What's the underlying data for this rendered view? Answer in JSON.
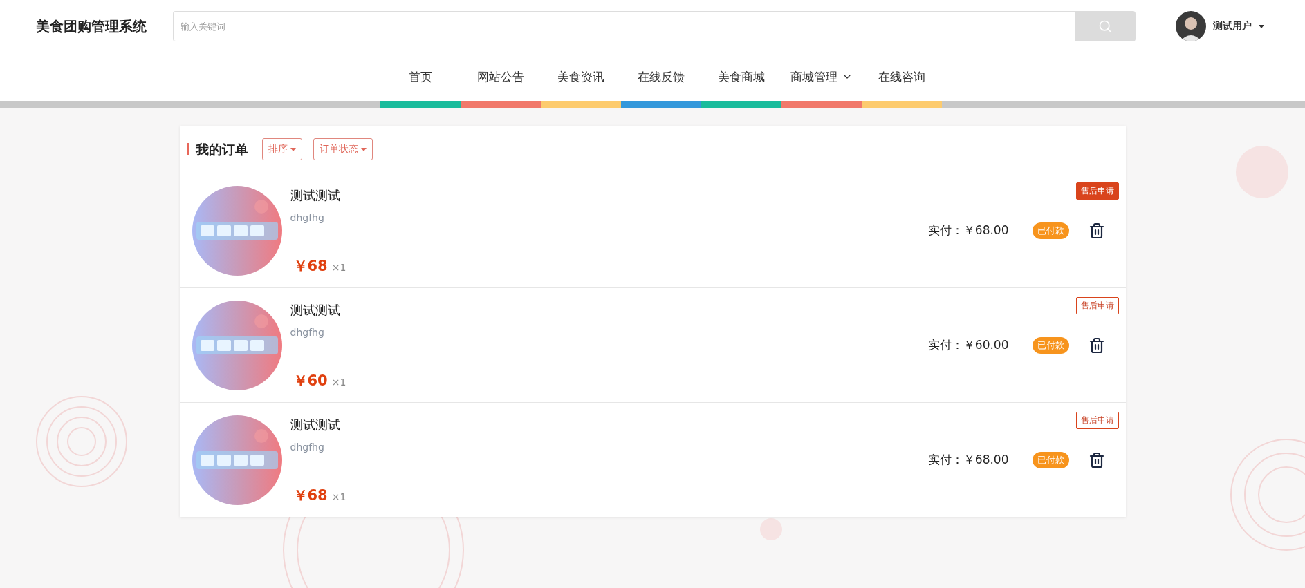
{
  "header": {
    "site_title": "美食团购管理系统",
    "search": {
      "placeholder": "输入关键词"
    },
    "user": {
      "name": "测试用户"
    }
  },
  "nav": [
    {
      "label": "首页",
      "color": "#1abc9c",
      "dropdown": false
    },
    {
      "label": "网站公告",
      "color": "#f1786a",
      "dropdown": false
    },
    {
      "label": "美食资讯",
      "color": "#fdcb6e",
      "dropdown": false
    },
    {
      "label": "在线反馈",
      "color": "#3498db",
      "dropdown": false
    },
    {
      "label": "美食商城",
      "color": "#1abc9c",
      "dropdown": false
    },
    {
      "label": "商城管理",
      "color": "#f1786a",
      "dropdown": true
    },
    {
      "label": "在线咨询",
      "color": "#fdcb6e",
      "dropdown": false
    }
  ],
  "orders": {
    "title": "我的订单",
    "filters": [
      "排序",
      "订单状态"
    ],
    "items": [
      {
        "name": "测试测试",
        "description": "dhgfhg",
        "price": "￥68",
        "quantity": "×1",
        "paid": "实付：￥68.00",
        "status": "已付款",
        "action": "售后申请",
        "highlighted": true
      },
      {
        "name": "测试测试",
        "description": "dhgfhg",
        "price": "￥60",
        "quantity": "×1",
        "paid": "实付：￥60.00",
        "status": "已付款",
        "action": "售后申请",
        "highlighted": false
      },
      {
        "name": "测试测试",
        "description": "dhgfhg",
        "price": "￥68",
        "quantity": "×1",
        "paid": "实付：￥68.00",
        "status": "已付款",
        "action": "售后申请",
        "highlighted": false
      }
    ]
  }
}
